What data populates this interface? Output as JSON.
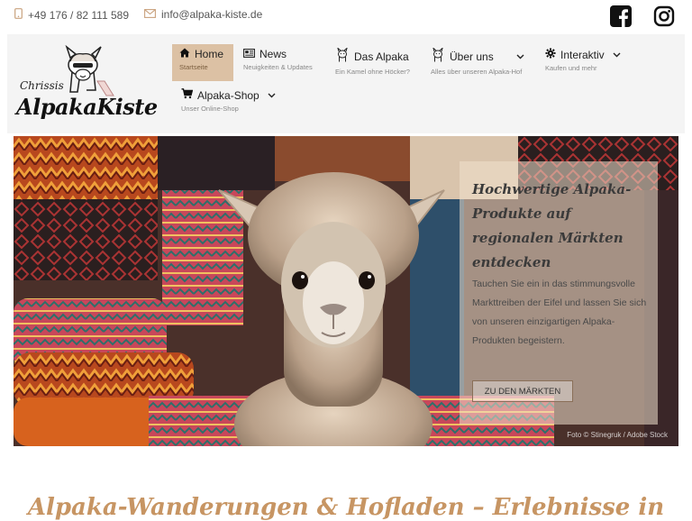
{
  "topbar": {
    "phone": "+49 176 / 82 111 589",
    "email": "info@alpaka-kiste.de",
    "social": [
      "facebook-icon",
      "instagram-icon"
    ]
  },
  "logo": {
    "line1": "Chrissis",
    "line2": "AlpakaKiste"
  },
  "nav": {
    "items": [
      {
        "label": "Home",
        "sub": "Startseite",
        "icon": "home-icon",
        "active": true
      },
      {
        "label": "News",
        "sub": "Neuigkeiten & Updates",
        "icon": "newspaper-icon"
      },
      {
        "label": "Das Alpaka",
        "sub": "Ein Kamel ohne Höcker?",
        "icon": "alpaca-icon"
      },
      {
        "label": "Über uns",
        "sub": "Alles über unseren Alpaka-Hof",
        "icon": "alpaca-icon",
        "dropdown": true
      },
      {
        "label": "Interaktiv",
        "sub": "Kaufen und mehr",
        "icon": "gear-icon",
        "dropdown": true
      },
      {
        "label": "Alpaka-Shop",
        "sub": "Unser Online-Shop",
        "icon": "cart-icon",
        "dropdown": true
      }
    ]
  },
  "hero": {
    "title": "Hochwertige Alpaka-Produkte auf regionalen Märkten entdecken",
    "text": "Tauchen Sie ein in das stimmungsvolle Markttreiben der Eifel und lassen Sie sich von unseren einzigartigen Alpaka-Produkten begeistern.",
    "button": "ZU DEN MÄRKTEN",
    "credit": "Foto © Stinegruk / Adobe Stock"
  },
  "section": {
    "title": "Alpaka-Wanderungen & Hofladen – Erlebnisse in"
  },
  "colors": {
    "accent": "#c79563",
    "nav_active": "#dcc1a4"
  }
}
